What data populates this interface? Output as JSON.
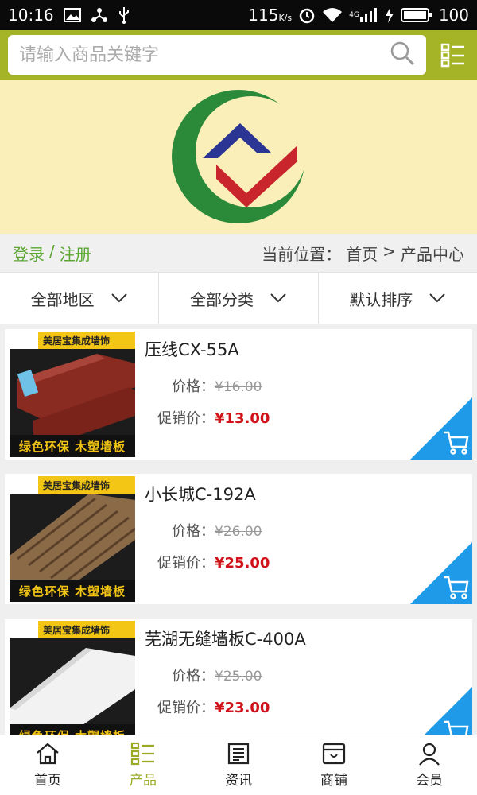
{
  "status_bar": {
    "time": "10:16",
    "speed": "115",
    "speed_unit": "K/s",
    "network": "4G",
    "battery": "100"
  },
  "search": {
    "placeholder": "请输入商品关键字"
  },
  "breadcrumb": {
    "login": "登录",
    "separator": "/",
    "register": "注册",
    "location_label": "当前位置：",
    "home": "首页",
    "arrow": ">",
    "current": "产品中心"
  },
  "filters": [
    {
      "label": "全部地区"
    },
    {
      "label": "全部分类"
    },
    {
      "label": "默认排序"
    }
  ],
  "product_image": {
    "brand": "美居宝集成墙饰",
    "slogan": "绿色环保 木塑墙板"
  },
  "products": [
    {
      "name": "压线CX-55A",
      "price_label": "价格：",
      "price": "¥16.00",
      "promo_label": "促销价：",
      "promo_price": "¥13.00"
    },
    {
      "name": "小长城C-192A",
      "price_label": "价格：",
      "price": "¥26.00",
      "promo_label": "促销价：",
      "promo_price": "¥25.00"
    },
    {
      "name": "芜湖无缝墙板C-400A",
      "price_label": "价格：",
      "price": "¥25.00",
      "promo_label": "促销价：",
      "promo_price": "¥23.00"
    }
  ],
  "tabs": [
    {
      "label": "首页",
      "icon": "home-icon"
    },
    {
      "label": "产品",
      "icon": "list-icon"
    },
    {
      "label": "资讯",
      "icon": "news-icon"
    },
    {
      "label": "商铺",
      "icon": "shop-icon"
    },
    {
      "label": "会员",
      "icon": "user-icon"
    }
  ],
  "colors": {
    "header": "#a4b426",
    "banner": "#fbefb9",
    "accent_green": "#5aa630",
    "promo_red": "#d0131a",
    "cart_blue": "#1e9ae8",
    "tab_active": "#9aab23"
  }
}
